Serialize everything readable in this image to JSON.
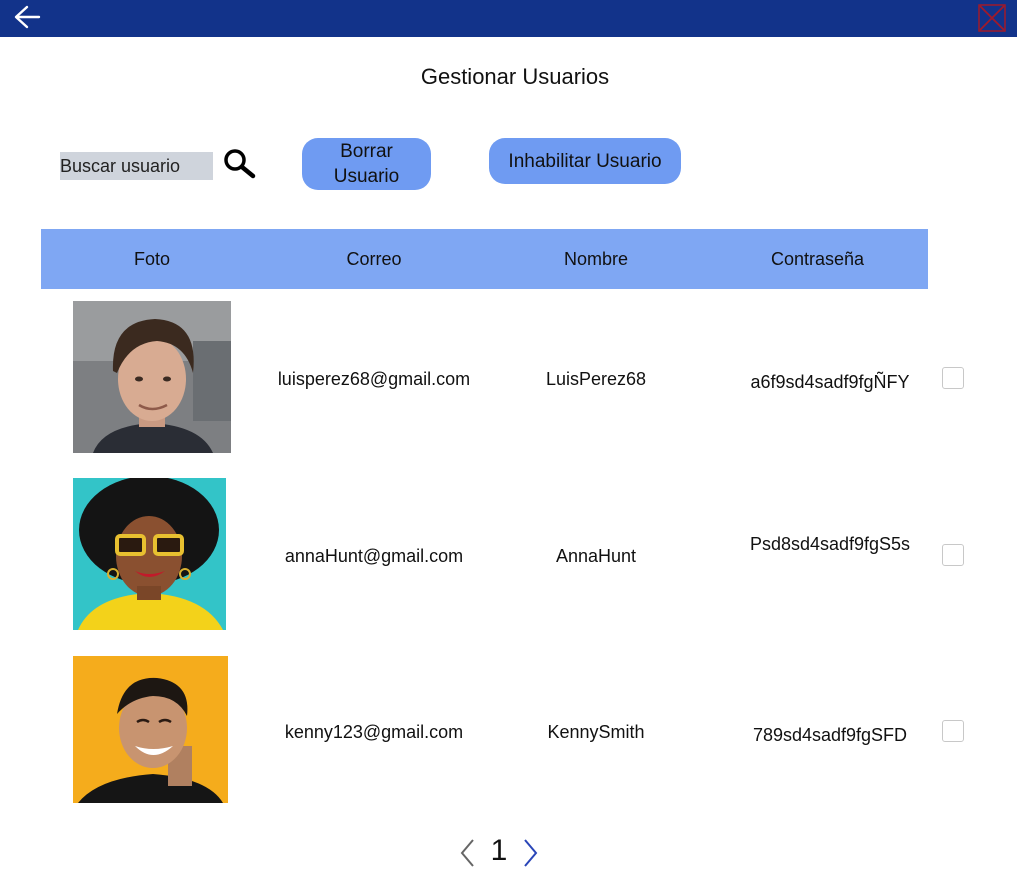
{
  "header": {
    "back_icon": "arrow-left-icon",
    "close_icon": "close-x-icon",
    "bar_color": "#12338a"
  },
  "page": {
    "title": "Gestionar Usuarios"
  },
  "toolbar": {
    "search_placeholder": "Buscar usuario",
    "search_icon": "search-icon",
    "delete_label_line1": "Borrar",
    "delete_label_line2": "Usuario",
    "disable_label": "Inhabilitar Usuario",
    "button_color": "#6f9bf2"
  },
  "table": {
    "header_color": "#7fa7f3",
    "columns": [
      "Foto",
      "Correo",
      "Nombre",
      "Contraseña"
    ],
    "rows": [
      {
        "email": "luisperez68@gmail.com",
        "name": "LuisPerez68",
        "password": "a6f9sd4sadf9fgÑFY",
        "checked": false
      },
      {
        "email": "annaHunt@gmail.com",
        "name": "AnnaHunt",
        "password": "Psd8sd4sadf9fgS5s",
        "checked": false
      },
      {
        "email": "kenny123@gmail.com",
        "name": "KennySmith",
        "password": "789sd4sadf9fgSFD",
        "checked": false
      }
    ]
  },
  "pagination": {
    "current_page": "1",
    "prev_icon": "chevron-left-icon",
    "next_icon": "chevron-right-icon"
  }
}
